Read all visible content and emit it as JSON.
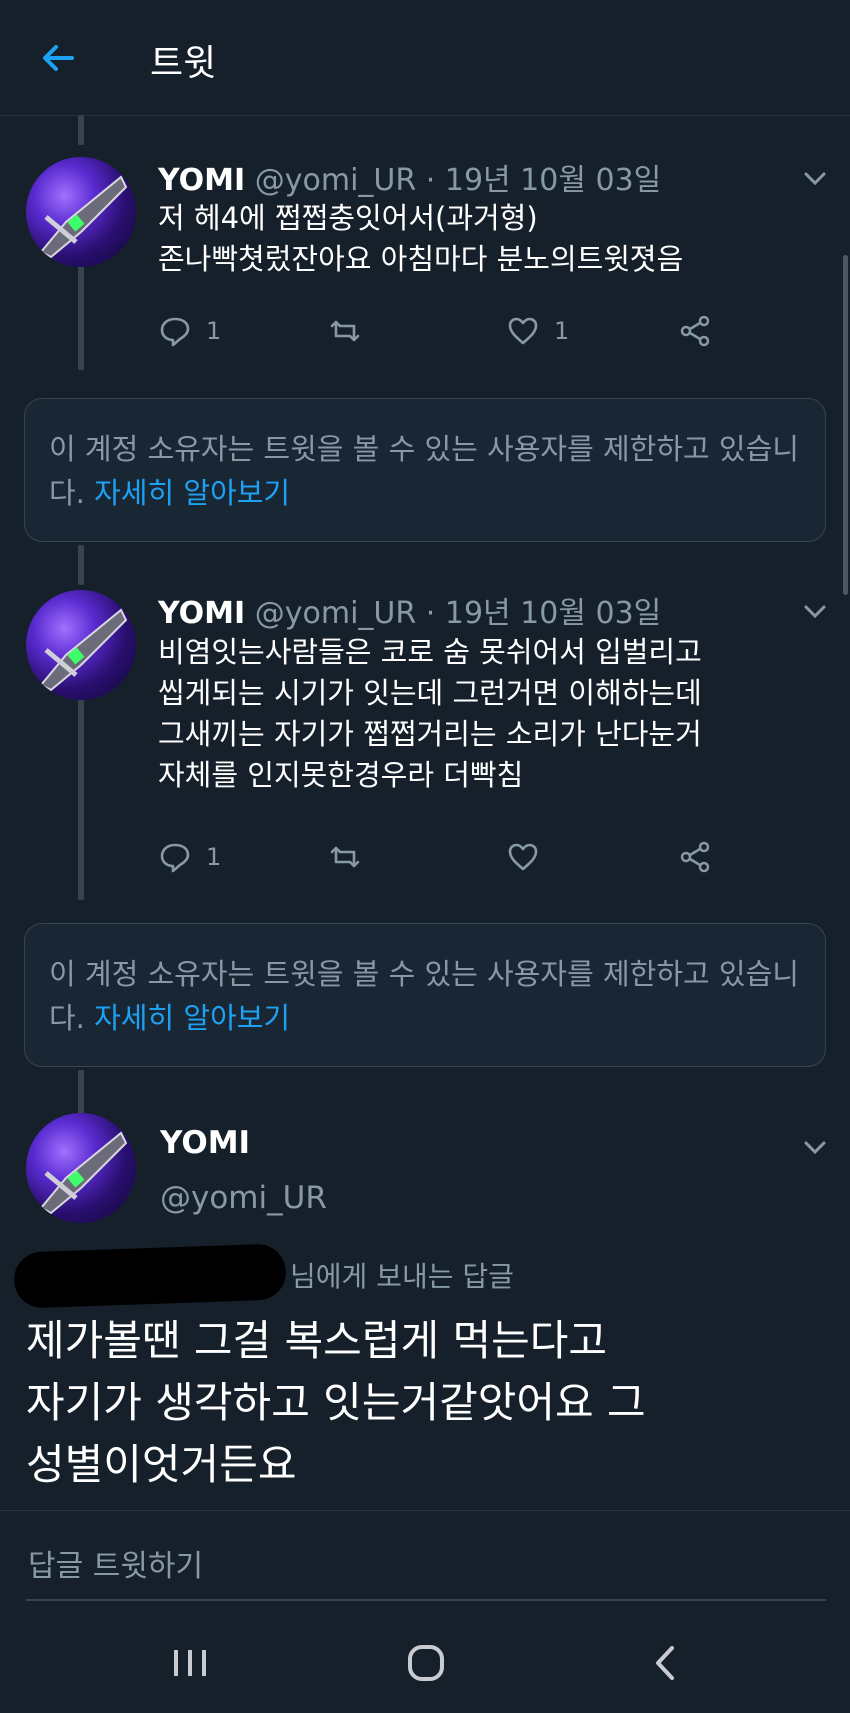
{
  "header": {
    "title": "트윗"
  },
  "tweets": [
    {
      "name": "YOMI",
      "handle": "@yomi_UR",
      "sep": "·",
      "date": "19년 10월 03일",
      "lines": [
        "저 헤4에 쩝쩝충잇어서(과거형)",
        "존나빡쳣렀잔아요 아침마다 분노의트윗졋음"
      ],
      "replies": "1",
      "retweets": "",
      "likes": "1"
    },
    {
      "name": "YOMI",
      "handle": "@yomi_UR",
      "sep": "·",
      "date": "19년 10월 03일",
      "lines": [
        "비염잇는사람들은 코로 숨 못쉬어서 입벌리고",
        "씹게되는 시기가 잇는데 그런거면 이해하는데",
        "그새끼는 자기가 쩝쩝거리는 소리가 난다눈거",
        "자체를 인지못한경우라 더빡침"
      ],
      "replies": "1",
      "retweets": "",
      "likes": ""
    }
  ],
  "notice": {
    "text": "이 계정 소유자는 트윗을 볼 수 있는 사용자를 제한하고 있습니다.",
    "link": "자세히 알아보기"
  },
  "focus": {
    "name": "YOMI",
    "handle": "@yomi_UR",
    "reply_to": "님에게 보내는 답글",
    "lines": [
      "제가볼땐 그걸 복스럽게 먹는다고",
      "자기가 생각하고 잇는거같앗어요 그",
      "성별이엇거든요"
    ]
  },
  "reply_bar": {
    "placeholder": "답글 트윗하기"
  },
  "colors": {
    "background": "#15202b",
    "accent": "#1da1f2",
    "muted": "#8899a6",
    "border": "#38444d"
  }
}
